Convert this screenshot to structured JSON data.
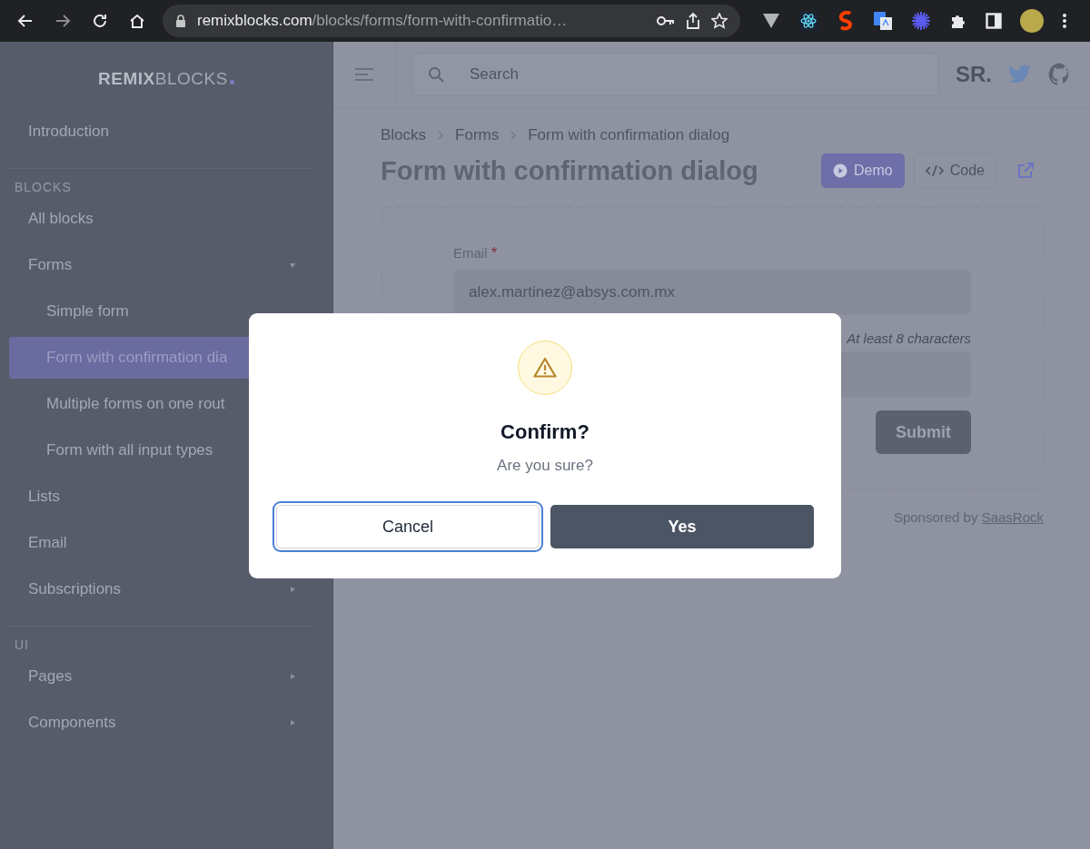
{
  "browser": {
    "url_host": "remixblocks.com",
    "url_path": "/blocks/forms/form-with-confirmatio…"
  },
  "sidebar": {
    "logo_bold": "REMIX",
    "logo_light": "BLOCKS",
    "sections": [
      {
        "items": [
          {
            "label": "Introduction",
            "selected": false
          }
        ]
      },
      {
        "heading": "BLOCKS",
        "items": [
          {
            "label": "All blocks",
            "selected": false
          },
          {
            "label": "Forms",
            "selected": false,
            "expanded": true,
            "children": [
              {
                "label": "Simple form",
                "selected": false
              },
              {
                "label": "Form with confirmation dia",
                "selected": true
              },
              {
                "label": "Multiple forms on one rout",
                "selected": false
              },
              {
                "label": "Form with all input types",
                "selected": false
              }
            ]
          },
          {
            "label": "Lists",
            "selected": false
          },
          {
            "label": "Email",
            "selected": false
          },
          {
            "label": "Subscriptions",
            "selected": false,
            "expanded": false
          }
        ]
      },
      {
        "heading": "UI",
        "items": [
          {
            "label": "Pages",
            "selected": false,
            "expanded": false
          },
          {
            "label": "Components",
            "selected": false,
            "expanded": false
          }
        ]
      }
    ]
  },
  "header": {
    "search": {
      "placeholder": "Search"
    },
    "brand": "SR."
  },
  "breadcrumb": [
    "Blocks",
    "Forms",
    "Form with confirmation dialog"
  ],
  "title": "Form with confirmation dialog",
  "view_tabs": [
    {
      "label": "Demo",
      "kind": "demo",
      "selected": true
    },
    {
      "label": "Code",
      "kind": "code",
      "selected": false
    }
  ],
  "form": {
    "email_label": "Email",
    "required_mark": "*",
    "email_value": "alex.martinez@absys.com.mx",
    "password_hint": "At least 8 characters",
    "submit": "Submit"
  },
  "sponsor": {
    "text": "Sponsored by",
    "link": "SaasRock"
  },
  "dialog": {
    "title": "Confirm?",
    "message": "Are you sure?",
    "buttons": [
      {
        "label": "Cancel",
        "kind": "secondary",
        "focused": true
      },
      {
        "label": "Yes",
        "kind": "primary",
        "focused": false
      }
    ]
  }
}
